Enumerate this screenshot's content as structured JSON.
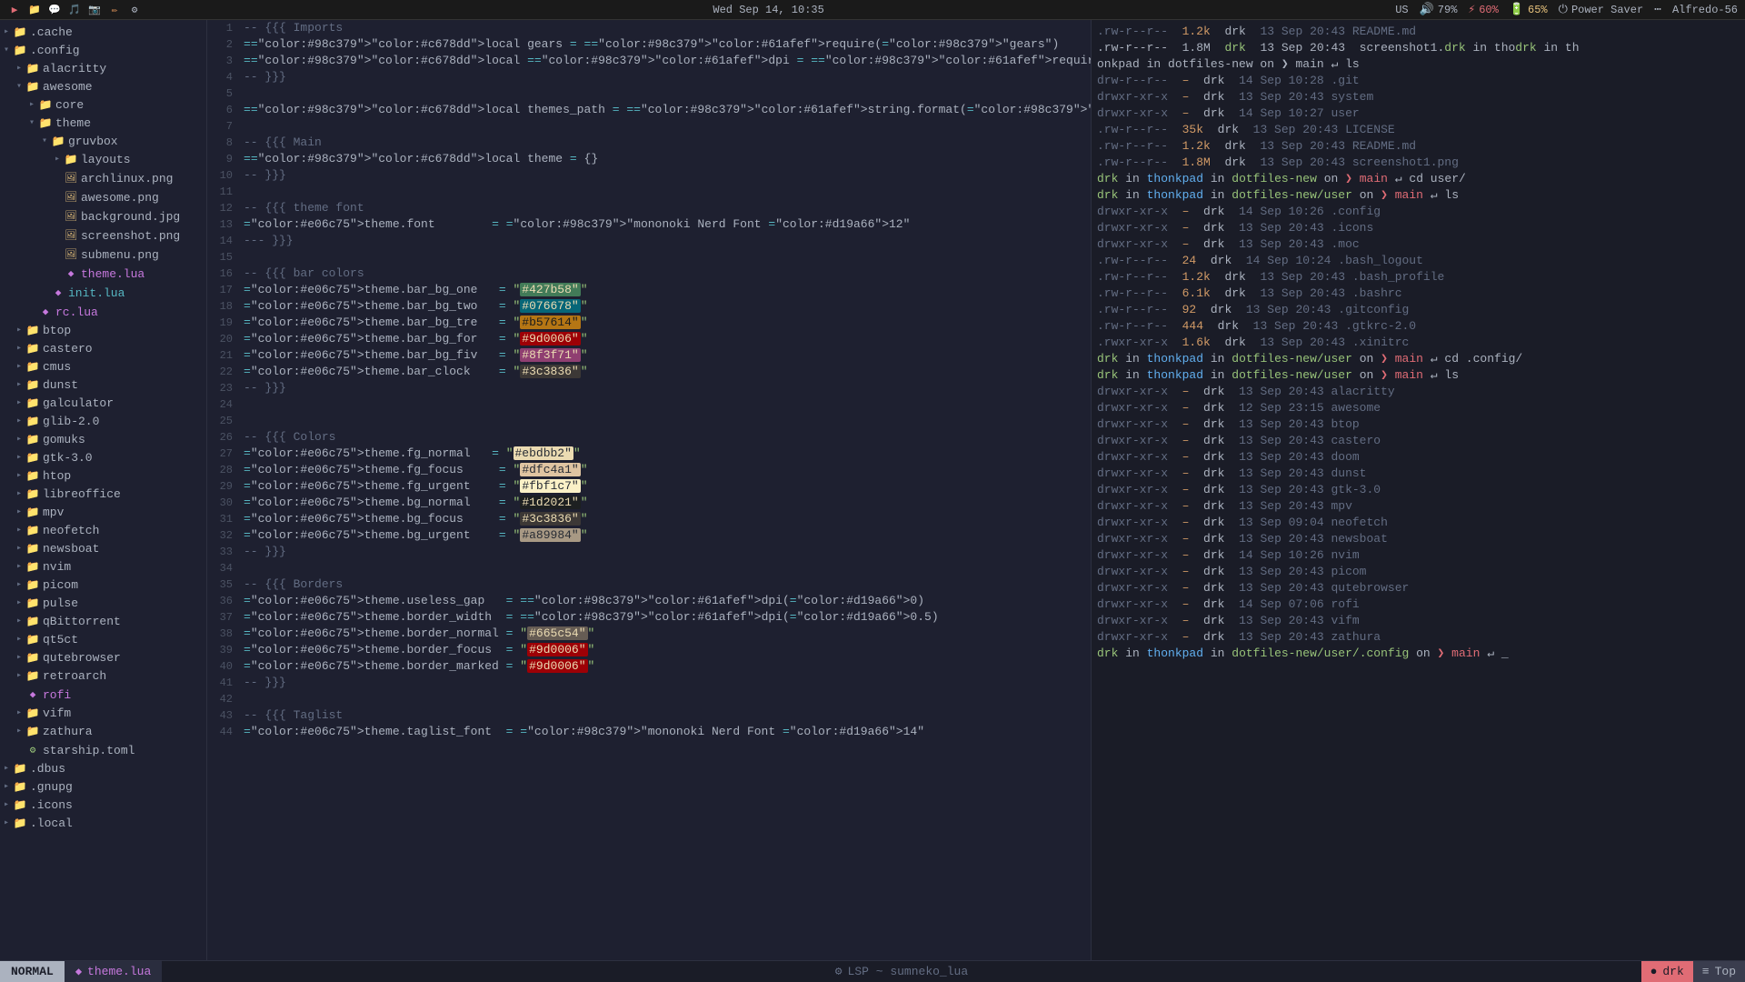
{
  "topbar": {
    "icons": [
      "▶",
      "📁",
      "💬",
      "🎵",
      "📷",
      "✏",
      "⚙"
    ],
    "datetime": "Wed Sep 14, 10:35",
    "status": {
      "kb": "US",
      "vol_icon": "🔊",
      "vol": "79%",
      "bat_charge": "60%",
      "bat": "65%",
      "power": "Power Saver",
      "wifi_icon": "WiFi",
      "user": "Alfredo-56"
    }
  },
  "sidebar": {
    "items": [
      {
        "id": "cache",
        "label": ".cache",
        "indent": 0,
        "type": "dir",
        "expanded": false
      },
      {
        "id": "config",
        "label": ".config",
        "indent": 0,
        "type": "dir",
        "expanded": true
      },
      {
        "id": "alacritty",
        "label": "alacritty",
        "indent": 1,
        "type": "dir",
        "expanded": false
      },
      {
        "id": "awesome",
        "label": "awesome",
        "indent": 1,
        "type": "dir",
        "expanded": true
      },
      {
        "id": "core",
        "label": "core",
        "indent": 2,
        "type": "dir",
        "expanded": false
      },
      {
        "id": "theme",
        "label": "theme",
        "indent": 2,
        "type": "dir",
        "expanded": true
      },
      {
        "id": "gruvbox",
        "label": "gruvbox",
        "indent": 3,
        "type": "dir",
        "expanded": true
      },
      {
        "id": "layouts",
        "label": "layouts",
        "indent": 4,
        "type": "dir",
        "expanded": false
      },
      {
        "id": "archlinux",
        "label": "archlinux.png",
        "indent": 4,
        "type": "png"
      },
      {
        "id": "awesome-png",
        "label": "awesome.png",
        "indent": 4,
        "type": "png"
      },
      {
        "id": "background",
        "label": "background.jpg",
        "indent": 4,
        "type": "jpg"
      },
      {
        "id": "screenshot",
        "label": "screenshot.png",
        "indent": 4,
        "type": "png"
      },
      {
        "id": "submenu",
        "label": "submenu.png",
        "indent": 4,
        "type": "png"
      },
      {
        "id": "theme-lua",
        "label": "theme.lua",
        "indent": 4,
        "type": "lua",
        "selected": true
      },
      {
        "id": "init-lua",
        "label": "init.lua",
        "indent": 3,
        "type": "lua-init"
      },
      {
        "id": "rc-lua",
        "label": "rc.lua",
        "indent": 2,
        "type": "lua"
      },
      {
        "id": "btop",
        "label": "btop",
        "indent": 1,
        "type": "dir",
        "expanded": false
      },
      {
        "id": "castero",
        "label": "castero",
        "indent": 1,
        "type": "dir",
        "expanded": false
      },
      {
        "id": "cmus",
        "label": "cmus",
        "indent": 1,
        "type": "dir",
        "expanded": false
      },
      {
        "id": "dunst",
        "label": "dunst",
        "indent": 1,
        "type": "dir",
        "expanded": false
      },
      {
        "id": "galculator",
        "label": "galculator",
        "indent": 1,
        "type": "dir",
        "expanded": false
      },
      {
        "id": "glib-2.0",
        "label": "glib-2.0",
        "indent": 1,
        "type": "dir",
        "expanded": false
      },
      {
        "id": "gomuks",
        "label": "gomuks",
        "indent": 1,
        "type": "dir",
        "expanded": false
      },
      {
        "id": "gtk-3.0",
        "label": "gtk-3.0",
        "indent": 1,
        "type": "dir",
        "expanded": false
      },
      {
        "id": "htop",
        "label": "htop",
        "indent": 1,
        "type": "dir",
        "expanded": false
      },
      {
        "id": "libreoffice",
        "label": "libreoffice",
        "indent": 1,
        "type": "dir",
        "expanded": false
      },
      {
        "id": "mpv",
        "label": "mpv",
        "indent": 1,
        "type": "dir",
        "expanded": false
      },
      {
        "id": "neofetch",
        "label": "neofetch",
        "indent": 1,
        "type": "dir",
        "expanded": false
      },
      {
        "id": "newsboat",
        "label": "newsboat",
        "indent": 1,
        "type": "dir",
        "expanded": false
      },
      {
        "id": "nvim",
        "label": "nvim",
        "indent": 1,
        "type": "dir",
        "expanded": false
      },
      {
        "id": "picom",
        "label": "picom",
        "indent": 1,
        "type": "dir",
        "expanded": false
      },
      {
        "id": "pulse",
        "label": "pulse",
        "indent": 1,
        "type": "dir",
        "expanded": false
      },
      {
        "id": "qBittorrent",
        "label": "qBittorrent",
        "indent": 1,
        "type": "dir",
        "expanded": false
      },
      {
        "id": "qt5ct",
        "label": "qt5ct",
        "indent": 1,
        "type": "dir",
        "expanded": false
      },
      {
        "id": "qutebrowser",
        "label": "qutebrowser",
        "indent": 1,
        "type": "dir",
        "expanded": false
      },
      {
        "id": "retroarch",
        "label": "retroarch",
        "indent": 1,
        "type": "dir",
        "expanded": false
      },
      {
        "id": "rofi",
        "label": "rofi",
        "indent": 1,
        "type": "lua",
        "expanded": false
      },
      {
        "id": "vifm",
        "label": "vifm",
        "indent": 1,
        "type": "dir",
        "expanded": false
      },
      {
        "id": "zathura",
        "label": "zathura",
        "indent": 1,
        "type": "dir",
        "expanded": false
      },
      {
        "id": "starship",
        "label": "starship.toml",
        "indent": 1,
        "type": "toml"
      },
      {
        "id": "dbus",
        "label": ".dbus",
        "indent": 0,
        "type": "dir",
        "expanded": false
      },
      {
        "id": "gnupg",
        "label": ".gnupg",
        "indent": 0,
        "type": "dir",
        "expanded": false
      },
      {
        "id": "icons",
        "label": ".icons",
        "indent": 0,
        "type": "dir",
        "expanded": false
      },
      {
        "id": "local",
        "label": ".local",
        "indent": 0,
        "type": "dir",
        "expanded": false
      }
    ]
  },
  "editor": {
    "lines": [
      {
        "num": 1,
        "content": "-- {{{ Imports"
      },
      {
        "num": 2,
        "content": "local gears = require(\"gears\")"
      },
      {
        "num": 3,
        "content": "local dpi = require(\"beautiful.xresources\").apply_dpi"
      },
      {
        "num": 4,
        "content": "-- }}}"
      },
      {
        "num": 5,
        "content": ""
      },
      {
        "num": 6,
        "content": "local themes_path = string.format(\"%s/.config/awesome/theme/\", os.getenv(\"HOME\"))"
      },
      {
        "num": 7,
        "content": ""
      },
      {
        "num": 8,
        "content": "-- {{{ Main"
      },
      {
        "num": 9,
        "content": "local theme = {}"
      },
      {
        "num": 10,
        "content": "-- }}}"
      },
      {
        "num": 11,
        "content": ""
      },
      {
        "num": 12,
        "content": "-- {{{ theme font"
      },
      {
        "num": 13,
        "content": "theme.font        = \"mononoki Nerd Font 12\""
      },
      {
        "num": 14,
        "content": "--- }}}"
      },
      {
        "num": 15,
        "content": ""
      },
      {
        "num": 16,
        "content": "-- {{{ bar colors"
      },
      {
        "num": 17,
        "content": "theme.bar_bg_one   = \"#427b58\"",
        "hl": "427b58"
      },
      {
        "num": 18,
        "content": "theme.bar_bg_two   = \"#076678\"",
        "hl": "076678"
      },
      {
        "num": 19,
        "content": "theme.bar_bg_tre   = \"#b57614\"",
        "hl": "b57614"
      },
      {
        "num": 20,
        "content": "theme.bar_bg_for   = \"#9d0006\"",
        "hl": "9d0006"
      },
      {
        "num": 21,
        "content": "theme.bar_bg_fiv   = \"#8f3f71\"",
        "hl": "8f3f71"
      },
      {
        "num": 22,
        "content": "theme.bar_clock    = \"#3c3836\"",
        "hl": "3c3836"
      },
      {
        "num": 23,
        "content": "-- }}}"
      },
      {
        "num": 24,
        "content": ""
      },
      {
        "num": 25,
        "content": ""
      },
      {
        "num": 26,
        "content": "-- {{{ Colors"
      },
      {
        "num": 27,
        "content": "theme.fg_normal   = \"#ebdbb2\"",
        "hl": "ebdbb2"
      },
      {
        "num": 28,
        "content": "theme.fg_focus     = \"#dfc4a1\"",
        "hl": "dfc4a1"
      },
      {
        "num": 29,
        "content": "theme.fg_urgent    = \"#fbf1c7\"",
        "hl": "fbf1c7"
      },
      {
        "num": 30,
        "content": "theme.bg_normal    = \"#1d2021\"",
        "hl": "1d2021"
      },
      {
        "num": 31,
        "content": "theme.bg_focus     = \"#3c3836\"",
        "hl": "3c3836b"
      },
      {
        "num": 32,
        "content": "theme.bg_urgent    = \"#a89984\"",
        "hl": "a89984"
      },
      {
        "num": 33,
        "content": "-- }}}"
      },
      {
        "num": 34,
        "content": ""
      },
      {
        "num": 35,
        "content": "-- {{{ Borders"
      },
      {
        "num": 36,
        "content": "theme.useless_gap   = dpi(0)"
      },
      {
        "num": 37,
        "content": "theme.border_width  = dpi(0.5)"
      },
      {
        "num": 38,
        "content": "theme.border_normal = \"#665c54\"",
        "hl": "665c54"
      },
      {
        "num": 39,
        "content": "theme.border_focus  = \"#9d0006\"",
        "hl": "9d0006b"
      },
      {
        "num": 40,
        "content": "theme.border_marked = \"#9d0006\"",
        "hl": "9d0006c"
      },
      {
        "num": 41,
        "content": "-- }}}"
      },
      {
        "num": 42,
        "content": ""
      },
      {
        "num": 43,
        "content": "-- {{{ Taglist"
      },
      {
        "num": 44,
        "content": "theme.taglist_font  = \"mononoki Nerd Font 14\""
      }
    ]
  },
  "terminal": {
    "lines": [
      ".rw-r--r--  1.2k  drk  13 Sep 20:43  README.md",
      ".rw-r--r--  1.8M  drk  13 Sep 20:43  screenshot1.drk in thodrk in th",
      "onkpad in dotfiles-new on ❯ main ↵ ls",
      "drw-r--r--  –  drk  14 Sep 10:28  .git",
      "drwxr-xr-x  –  drk  13 Sep 20:43  system",
      "drwxr-xr-x  –  drk  14 Sep 10:27  user",
      ".rw-r--r--  35k  drk  13 Sep 20:43  LICENSE",
      ".rw-r--r--  1.2k  drk  13 Sep 20:43  README.md",
      ".rw-r--r--  1.8M  drk  13 Sep 20:43  screenshot1.png",
      "drk in thonkpad in dotfiles-new on ❯ main ↵ cd user/",
      "drk in thonkpad in dotfiles-new/user on ❯ main ↵ ls",
      "drwxr-xr-x  –  drk  14 Sep 10:26  .config",
      "drwxr-xr-x  –  drk  13 Sep 20:43  .icons",
      "drwxr-xr-x  –  drk  13 Sep 20:43  .moc",
      ".rw-r--r--  24  drk  14 Sep 10:24  .bash_logout",
      ".rw-r--r--  1.2k  drk  13 Sep 20:43  .bash_profile",
      ".rw-r--r--  6.1k  drk  13 Sep 20:43  .bashrc",
      ".rw-r--r--  92  drk  13 Sep 20:43  .gitconfig",
      ".rw-r--r--  444  drk  13 Sep 20:43  .gtkrc-2.0",
      ".rwxr-xr-x  1.6k  drk  13 Sep 20:43  .xinitrc",
      "drk in thonkpad in dotfiles-new/user on ❯ main ↵ cd .config/",
      "drk in thonkpad in dotfiles-new/user on ❯ main ↵ ls",
      "drwxr-xr-x  –  drk  13 Sep 20:43  alacritty",
      "drwxr-xr-x  –  drk  12 Sep 23:15  awesome",
      "drwxr-xr-x  –  drk  13 Sep 20:43  btop",
      "drwxr-xr-x  –  drk  13 Sep 20:43  castero",
      "drwxr-xr-x  –  drk  13 Sep 20:43  doom",
      "drwxr-xr-x  –  drk  13 Sep 20:43  dunst",
      "drwxr-xr-x  –  drk  13 Sep 20:43  gtk-3.0",
      "drwxr-xr-x  –  drk  13 Sep 20:43  mpv",
      "drwxr-xr-x  –  drk  13 Sep 09:04  neofetch",
      "drwxr-xr-x  –  drk  13 Sep 20:43  newsboat",
      "drwxr-xr-x  –  drk  14 Sep 10:26  nvim",
      "drwxr-xr-x  –  drk  13 Sep 20:43  picom",
      "drwxr-xr-x  –  drk  13 Sep 20:43  qutebrowser",
      "drwxr-xr-x  –  drk  14 Sep 07:06  rofi",
      "drwxr-xr-x  –  drk  13 Sep 20:43  vifm",
      "drwxr-xr-x  –  drk  13 Sep 20:43  zathura",
      "drk in thonkpad in dotfiles-new/user/.config on ❯ main ↵ _"
    ]
  },
  "statusbar": {
    "mode": "NORMAL",
    "file_icon": "◆",
    "filename": "theme.lua",
    "mid_icon": "⚙",
    "mid_text": "LSP ~ sumneko_lua",
    "tag1": "drk",
    "tag2": "Top"
  }
}
